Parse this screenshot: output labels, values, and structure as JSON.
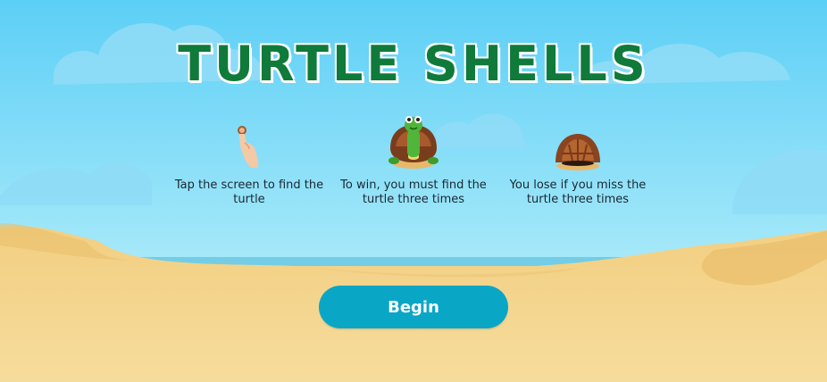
{
  "title": "TURTLE SHELLS",
  "instructions": [
    {
      "icon": "tap-finger-icon",
      "text": "Tap the screen to find the turtle"
    },
    {
      "icon": "turtle-icon",
      "text": "To win, you must find the turtle three times"
    },
    {
      "icon": "empty-shell-icon",
      "text": "You lose if you miss the turtle three times"
    }
  ],
  "begin_label": "Begin",
  "colors": {
    "sky_top": "#5fd0f7",
    "sky_bottom": "#bff2fb",
    "sand": "#f4d48a",
    "title_green": "#0f7a3a",
    "button": "#0aa6c6"
  }
}
